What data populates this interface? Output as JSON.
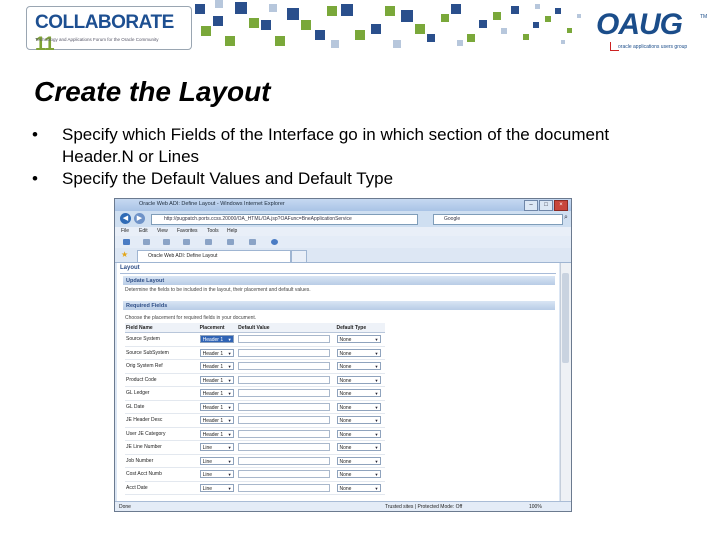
{
  "slide": {
    "title": "Create the Layout",
    "bullets": [
      "Specify which Fields of the Interface go in which section of the document  Header.N or Lines",
      "Specify the Default Values and Default Type"
    ],
    "bullet_char": "•"
  },
  "logos": {
    "collaborate": {
      "word": "COLLABORATE",
      "number": "11",
      "tagline": "Technology and Applications Forum for the Oracle Community"
    },
    "oaug": {
      "word": "OAUG",
      "tagline": "oracle applications users group",
      "tm": "TM"
    }
  },
  "browser": {
    "window_title": "Oracle Web ADI: Define Layout - Windows Internet Explorer",
    "address": "http://pugpatch.ports.ccss.20000/OA_HTML/OA.jsp?OAFunc=BneApplicationService",
    "search_placeholder": "Google",
    "menus": [
      "File",
      "Edit",
      "View",
      "Favorites",
      "Tools",
      "Help"
    ],
    "tab_label": "Oracle Web ADI: Define Layout",
    "status_left": "Done",
    "status_zone": "Trusted sites | Protected Mode: Off",
    "zoom": "100%",
    "glyphs": {
      "back": "◀",
      "forward": "▶",
      "dropdown": "▼",
      "close": "×",
      "minimize": "–",
      "maximize": "□",
      "search": "⌕",
      "star": "★"
    }
  },
  "page": {
    "heading": "Layout",
    "update_section": "Update Layout",
    "update_desc": "Determine the fields to be included in the layout, their placement and default values.",
    "required_section": "Required Fields",
    "required_desc": "Choose the placement for required fields in your document.",
    "columns": [
      "Field Name",
      "Placement",
      "Default Value",
      "Default Type"
    ],
    "rows": [
      {
        "field": "Source System",
        "placement": "Header 1",
        "default_type": "None"
      },
      {
        "field": "Source SubSystem",
        "placement": "Header 1",
        "default_type": "None"
      },
      {
        "field": "Orig System Ref",
        "placement": "Header 1",
        "default_type": "None"
      },
      {
        "field": "Product Code",
        "placement": "Header 1",
        "default_type": "None"
      },
      {
        "field": "GL Ledger",
        "placement": "Header 1",
        "default_type": "None"
      },
      {
        "field": "GL Date",
        "placement": "Header 1",
        "default_type": "None"
      },
      {
        "field": "JE Header Desc",
        "placement": "Header 1",
        "default_type": "None"
      },
      {
        "field": "User JE Category",
        "placement": "Header 1",
        "default_type": "None"
      },
      {
        "field": "JE Line Number",
        "placement": "Line",
        "default_type": "None"
      },
      {
        "field": "Job Number",
        "placement": "Line",
        "default_type": "None"
      },
      {
        "field": "Cost Acct Numb",
        "placement": "Line",
        "default_type": "None"
      },
      {
        "field": "Acct Date",
        "placement": "Line",
        "default_type": "None"
      }
    ]
  },
  "colors": {
    "title_text": "#000000",
    "ie_blue": "#2f6bb6",
    "oracle_header_blue": "#2e4e86",
    "selected_placement": "#2f63b5",
    "collab_blue": "#1d4f91",
    "collab_green": "#7fa336"
  }
}
